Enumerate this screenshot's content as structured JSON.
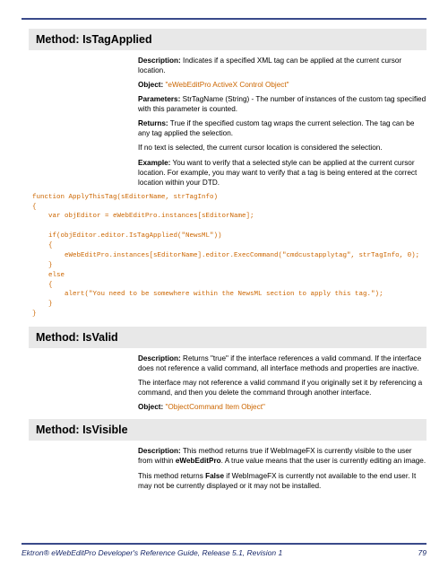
{
  "methods": [
    {
      "title": "Method: IsTagApplied",
      "paragraphs": [
        {
          "label": "Description:",
          "text": " Indicates if a specified XML tag can be applied at the current cursor location."
        },
        {
          "label": "Object:",
          "link": " \"eWebEditPro ActiveX Control Object\""
        },
        {
          "label": "Parameters:",
          "text": " StrTagName (String) - The number of instances of the custom tag specified with this parameter is counted."
        },
        {
          "label": "Returns:",
          "text": " True if the specified custom tag wraps the current selection. The tag can be any tag applied the selection."
        },
        {
          "plain": "If no text is selected, the current cursor location is considered the selection."
        },
        {
          "label": "Example:",
          "text": " You want to verify that a selected style can be applied at the current cursor location. For example, you may want to verify that a tag is being entered at the correct location within your DTD."
        }
      ],
      "code": "function ApplyThisTag(sEditorName, strTagInfo)\n{\n    var objEditor = eWebEditPro.instances[sEditorName];\n\n    if(objEditor.editor.IsTagApplied(\"NewsML\"))\n    {\n        eWebEditPro.instances[sEditorName].editor.ExecCommand(\"cmdcustapplytag\", strTagInfo, 0);\n    }\n    else\n    {\n        alert(\"You need to be somewhere within the NewsML section to apply this tag.\");\n    }\n}"
    },
    {
      "title": "Method: IsValid",
      "paragraphs": [
        {
          "label": "Description:",
          "text": " Returns \"true\" if the interface references a valid command. If the interface does not reference a valid command, all interface methods and properties are inactive."
        },
        {
          "plain": "The interface may not reference a valid command if you originally set it by referencing a command, and then you delete the command through another interface."
        },
        {
          "label": "Object:",
          "link": " \"ObjectCommand Item Object\""
        }
      ]
    },
    {
      "title": "Method: IsVisible",
      "paragraphs": [
        {
          "label": "Description:",
          "text_html": " This method returns true if WebImageFX is currently visible to the user from within <b>eWebEditPro</b>. A true value means that the user is currently editing an image."
        },
        {
          "plain_html": "This method returns <b>False</b> if WebImageFX is currently not available to the end user. It may not be currently displayed or it may not be installed."
        }
      ]
    }
  ],
  "footer": {
    "title": "Ektron® eWebEditPro Developer's Reference Guide, Release 5.1, Revision 1",
    "page": "79"
  }
}
